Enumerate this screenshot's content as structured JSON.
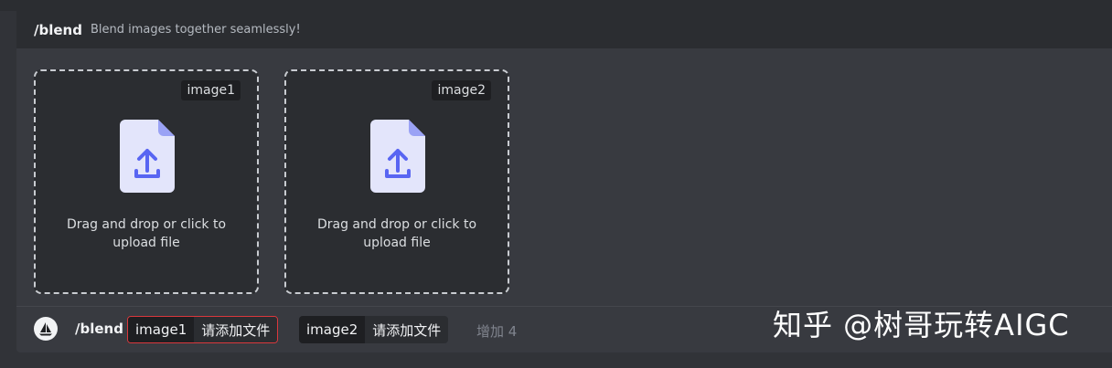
{
  "command": {
    "name": "/blend",
    "description": "Blend images together seamlessly!"
  },
  "dropzones": [
    {
      "tag": "image1",
      "text": "Drag and drop or click to upload file"
    },
    {
      "tag": "image2",
      "text": "Drag and drop or click to upload file"
    }
  ],
  "input_bar": {
    "command": "/blend",
    "options": [
      {
        "name": "image1",
        "value": "请添加文件"
      },
      {
        "name": "image2",
        "value": "请添加文件"
      }
    ],
    "more": "增加 4"
  },
  "watermark": "知乎 @树哥玩转AIGC",
  "colors": {
    "background": "#313338",
    "panel": "#383a40",
    "dropzone": "#2b2d31",
    "icon_accent": "#5865f2",
    "error_border": "#da373c"
  },
  "icons": {
    "upload": "upload-file-icon",
    "avatar": "midjourney-sailboat-icon"
  }
}
